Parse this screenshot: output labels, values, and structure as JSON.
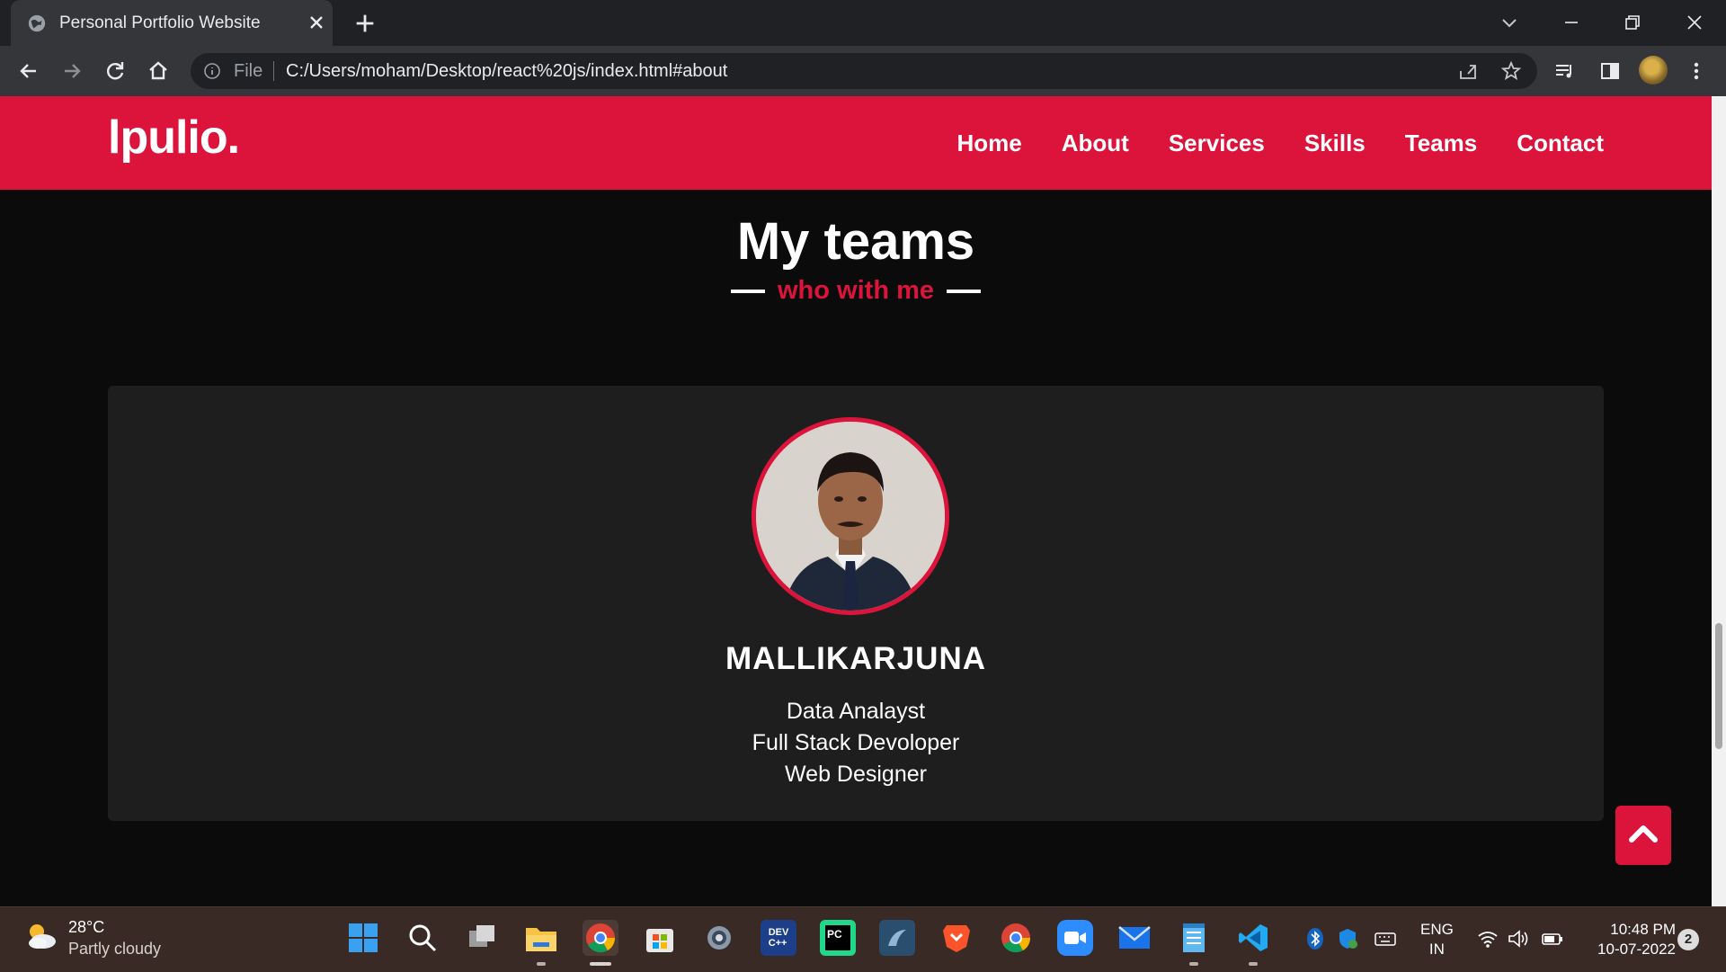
{
  "browser": {
    "tab_title": "Personal Portfolio Website",
    "file_label": "File",
    "url": "C:/Users/moham/Desktop/react%20js/index.html#about"
  },
  "site": {
    "logo": "lpulio.",
    "menu": [
      "Home",
      "About",
      "Services",
      "Skills",
      "Teams",
      "Contact"
    ],
    "accent_color": "#dc143c"
  },
  "teams_section": {
    "title": "My teams",
    "subtitle": "who with me",
    "member": {
      "name": "MALLIKARJUNA",
      "roles": [
        "Data Analayst",
        "Full Stack Devoloper",
        "Web Designer"
      ]
    }
  },
  "taskbar": {
    "weather_temp": "28°C",
    "weather_desc": "Partly cloudy",
    "lang_line1": "ENG",
    "lang_line2": "IN",
    "time": "10:48 PM",
    "date": "10-07-2022",
    "notifications": "2",
    "apps": [
      "windows-start",
      "search",
      "task-view",
      "file-explorer",
      "chrome",
      "microsoft-store",
      "settings",
      "dev-cpp",
      "pycharm",
      "mysql-workbench",
      "brave",
      "chrome-alt",
      "zoom",
      "mail",
      "notepad",
      "vscode"
    ]
  }
}
